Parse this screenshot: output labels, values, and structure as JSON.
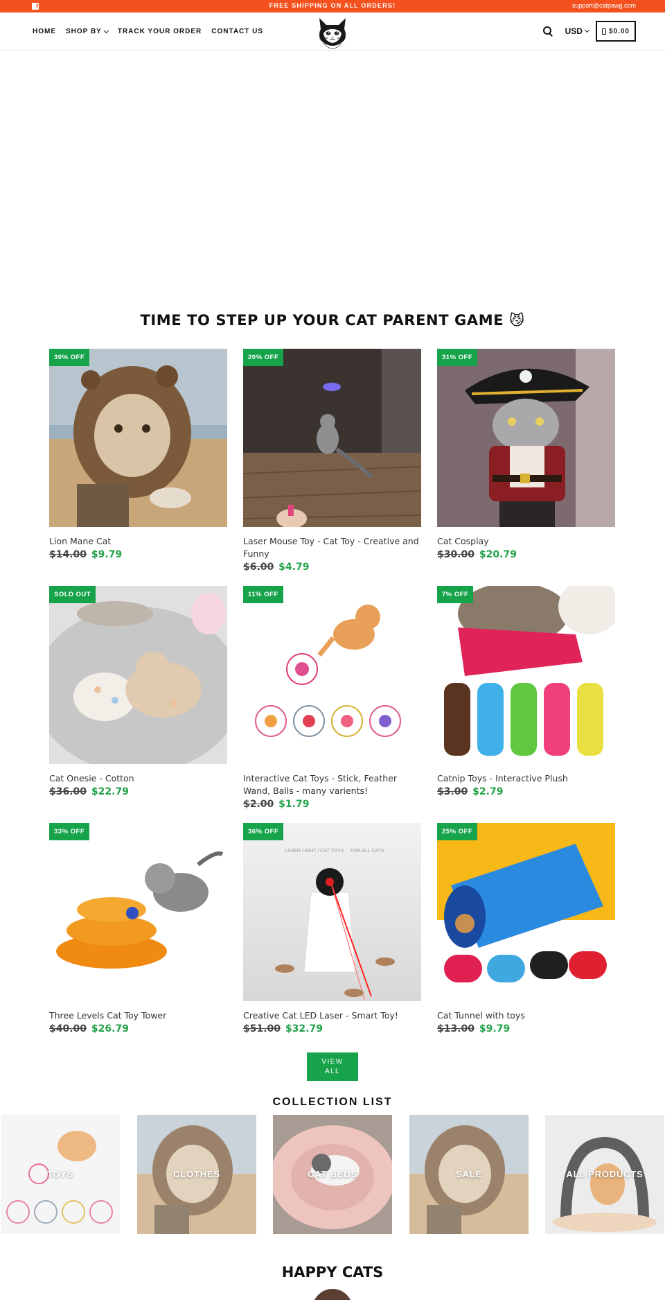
{
  "topbar": {
    "facebook_icon": "facebook-icon",
    "announcement": "FREE SHIPPING ON ALL ORDERS!",
    "email": "support@catpawg.com"
  },
  "header": {
    "nav": [
      {
        "label": "HOME"
      },
      {
        "label": "SHOP BY",
        "has_dropdown": true
      },
      {
        "label": "TRACK YOUR ORDER"
      },
      {
        "label": "CONTACT US"
      }
    ],
    "currency": "USD",
    "cart_total": "$0.00",
    "icons": {
      "search": "search-icon",
      "cart": "cart-icon",
      "logo": "cat-logo"
    }
  },
  "featured": {
    "title": "TIME TO STEP UP YOUR CAT PARENT GAME 😼",
    "products": [
      {
        "badge": "30% OFF",
        "name": "Lion Mane Cat",
        "old_price": "$14.00",
        "price": "$9.79"
      },
      {
        "badge": "20% OFF",
        "name": "Laser Mouse Toy - Cat Toy - Creative and Funny",
        "old_price": "$6.00",
        "price": "$4.79"
      },
      {
        "badge": "31% OFF",
        "name": "Cat Cosplay",
        "old_price": "$30.00",
        "price": "$20.79"
      },
      {
        "badge": "SOLD OUT",
        "name": "Cat Onesie - Cotton",
        "old_price": "$36.00",
        "price": "$22.79"
      },
      {
        "badge": "11% OFF",
        "name": "Interactive Cat Toys - Stick, Feather Wand, Balls - many varients!",
        "old_price": "$2.00",
        "price": "$1.79"
      },
      {
        "badge": "7% OFF",
        "name": "Catnip Toys - Interactive Plush",
        "old_price": "$3.00",
        "price": "$2.79"
      },
      {
        "badge": "33% OFF",
        "name": "Three Levels Cat Toy Tower",
        "old_price": "$40.00",
        "price": "$26.79"
      },
      {
        "badge": "36% OFF",
        "name": "Creative Cat LED Laser - Smart Toy!",
        "old_price": "$51.00",
        "price": "$32.79"
      },
      {
        "badge": "25% OFF",
        "name": "Cat Tunnel with toys",
        "old_price": "$13.00",
        "price": "$9.79"
      }
    ],
    "laser_image_text": {
      "left": "LASER LIGHT / CAT TOYS",
      "right": "FOR ALL CATS"
    },
    "view_all_line1": "VIEW",
    "view_all_line2": "ALL"
  },
  "collections": {
    "title": "COLLECTION LIST",
    "items": [
      {
        "label": "TOYS"
      },
      {
        "label": "CLOTHES"
      },
      {
        "label": "CAT BEDS"
      },
      {
        "label": "SALE"
      },
      {
        "label": "ALL PRODUCTS"
      }
    ]
  },
  "testimonials": {
    "title": "HAPPY CATS"
  },
  "colors": {
    "topbar": "#f4511e",
    "badge": "#16a34a",
    "sale_price": "#22a34a",
    "button": "#16a34a"
  }
}
